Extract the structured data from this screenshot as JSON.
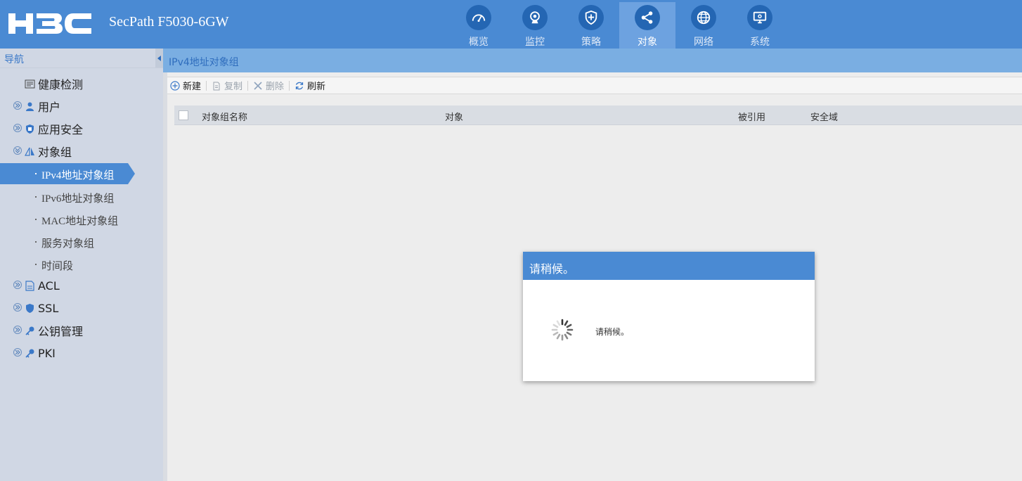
{
  "header": {
    "logo_text": "H3C",
    "product": "SecPath F5030-6GW",
    "tabs": [
      {
        "label": "概览",
        "icon": "dashboard-icon",
        "active": false
      },
      {
        "label": "监控",
        "icon": "camera-icon",
        "active": false
      },
      {
        "label": "策略",
        "icon": "shield-icon",
        "active": false
      },
      {
        "label": "对象",
        "icon": "share-nodes-icon",
        "active": true
      },
      {
        "label": "网络",
        "icon": "globe-icon",
        "active": false
      },
      {
        "label": "系统",
        "icon": "monitor-icon",
        "active": false
      }
    ]
  },
  "sidebar": {
    "title": "导航",
    "items": [
      {
        "label": "健康检测",
        "icon": "list-icon"
      },
      {
        "label": "用户",
        "icon": "user-icon"
      },
      {
        "label": "应用安全",
        "icon": "shield-icon"
      },
      {
        "label": "对象组",
        "icon": "object-group-icon"
      },
      {
        "label": "ACL",
        "icon": "acl-document-icon"
      },
      {
        "label": "SSL",
        "icon": "shield-icon"
      },
      {
        "label": "公钥管理",
        "icon": "key-icon"
      },
      {
        "label": "PKI",
        "icon": "key-icon"
      }
    ],
    "subitems": [
      {
        "label": "IPv4地址对象组",
        "active": true
      },
      {
        "label": "IPv6地址对象组",
        "active": false
      },
      {
        "label": "MAC地址对象组",
        "active": false
      },
      {
        "label": "服务对象组",
        "active": false
      },
      {
        "label": "时间段",
        "active": false
      }
    ]
  },
  "main": {
    "title": "IPv4地址对象组",
    "toolbar": {
      "new_label": "新建",
      "copy_label": "复制",
      "delete_label": "删除",
      "refresh_label": "刷新"
    },
    "table": {
      "columns": [
        "对象组名称",
        "对象",
        "被引用",
        "安全域"
      ]
    }
  },
  "modal": {
    "title": "请稍候。",
    "message": "请稍候。"
  },
  "colors": {
    "header_bg": "#4a8ad3",
    "active_tab_bg": "#6da2e0",
    "icon_circle": "#2466b3",
    "sidebar_bg": "#d0d7e4",
    "accent": "#4a8ad3"
  }
}
